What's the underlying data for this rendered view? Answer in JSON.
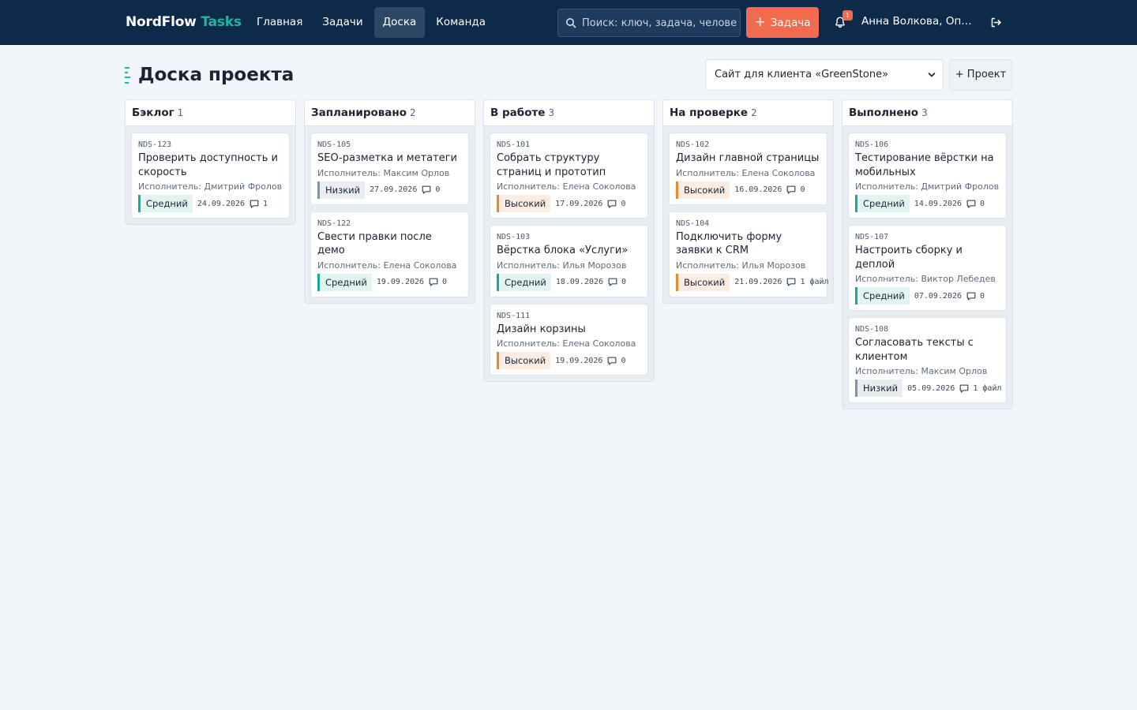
{
  "app": {
    "brand_main": "NordFlow",
    "brand_accent": "Tasks",
    "nav": [
      {
        "label": "Главная",
        "active": false
      },
      {
        "label": "Задачи",
        "active": false
      },
      {
        "label": "Доска",
        "active": true
      },
      {
        "label": "Команда",
        "active": false
      }
    ],
    "search_placeholder": "Поиск: ключ, задача, человек",
    "new_task_label": "Задача",
    "notifications_count": "1",
    "user_name": "Анна Волкова, Операционный менеджер",
    "icons": {
      "search": "search-icon",
      "bell": "bell-icon",
      "logout": "logout-icon",
      "plus": "plus-icon",
      "comment": "comment-icon"
    },
    "colors": {
      "nav_bg": "#0d2a4a",
      "accent": "#1fb6a4",
      "cta": "#f26b4f"
    }
  },
  "page": {
    "title": "Доска проекта",
    "project_selected": "Сайт для клиента «GreenStone»",
    "add_project_label": "+ Проект"
  },
  "priority_colors": {
    "Средний": "#1aa89a",
    "Высокий": "#e4892e",
    "Низкий": "#8193a8"
  },
  "board": {
    "assignee_prefix": "Исполнитель: ",
    "columns": [
      {
        "name": "Бэклог",
        "count": "1",
        "cards": [
          {
            "key": "NDS-123",
            "title": "Проверить доступность и скорость",
            "assignee": "Дмитрий Фролов",
            "priority": "Средний",
            "level": "mid",
            "due": "24.09.2026",
            "comments": "1"
          }
        ]
      },
      {
        "name": "Запланировано",
        "count": "2",
        "cards": [
          {
            "key": "NDS-105",
            "title": "SEO-разметка и метатеги",
            "assignee": "Максим Орлов",
            "priority": "Низкий",
            "level": "low",
            "due": "27.09.2026",
            "comments": "0"
          },
          {
            "key": "NDS-122",
            "title": "Свести правки после демо",
            "assignee": "Елена Соколова",
            "priority": "Средний",
            "level": "mid",
            "due": "19.09.2026",
            "comments": "0"
          }
        ]
      },
      {
        "name": "В работе",
        "count": "3",
        "cards": [
          {
            "key": "NDS-101",
            "title": "Собрать структуру страниц и прототип",
            "assignee": "Елена Соколова",
            "priority": "Высокий",
            "level": "high",
            "due": "17.09.2026",
            "comments": "0"
          },
          {
            "key": "NDS-103",
            "title": "Вёрстка блока «Услуги»",
            "assignee": "Илья Морозов",
            "priority": "Средний",
            "level": "mid",
            "due": "18.09.2026",
            "comments": "0"
          },
          {
            "key": "NDS-111",
            "title": "Дизайн корзины",
            "assignee": "Елена Соколова",
            "priority": "Высокий",
            "level": "high",
            "due": "19.09.2026",
            "comments": "0"
          }
        ]
      },
      {
        "name": "На проверке",
        "count": "2",
        "cards": [
          {
            "key": "NDS-102",
            "title": "Дизайн главной страницы",
            "assignee": "Елена Соколова",
            "priority": "Высокий",
            "level": "high",
            "due": "16.09.2026",
            "comments": "0"
          },
          {
            "key": "NDS-104",
            "title": "Подключить форму заявки к CRM",
            "assignee": "Илья Морозов",
            "priority": "Высокий",
            "level": "high",
            "due": "21.09.2026",
            "comments": "1 файл"
          }
        ]
      },
      {
        "name": "Выполнено",
        "count": "3",
        "cards": [
          {
            "key": "NDS-106",
            "title": "Тестирование вёрстки на мобильных",
            "assignee": "Дмитрий Фролов",
            "priority": "Средний",
            "level": "mid",
            "due": "14.09.2026",
            "comments": "0"
          },
          {
            "key": "NDS-107",
            "title": "Настроить сборку и деплой",
            "assignee": "Виктор Лебедев",
            "priority": "Средний",
            "level": "mid",
            "due": "07.09.2026",
            "comments": "0"
          },
          {
            "key": "NDS-108",
            "title": "Согласовать тексты с клиентом",
            "assignee": "Максим Орлов",
            "priority": "Низкий",
            "level": "low",
            "due": "05.09.2026",
            "comments": "1 файл"
          }
        ]
      }
    ]
  }
}
